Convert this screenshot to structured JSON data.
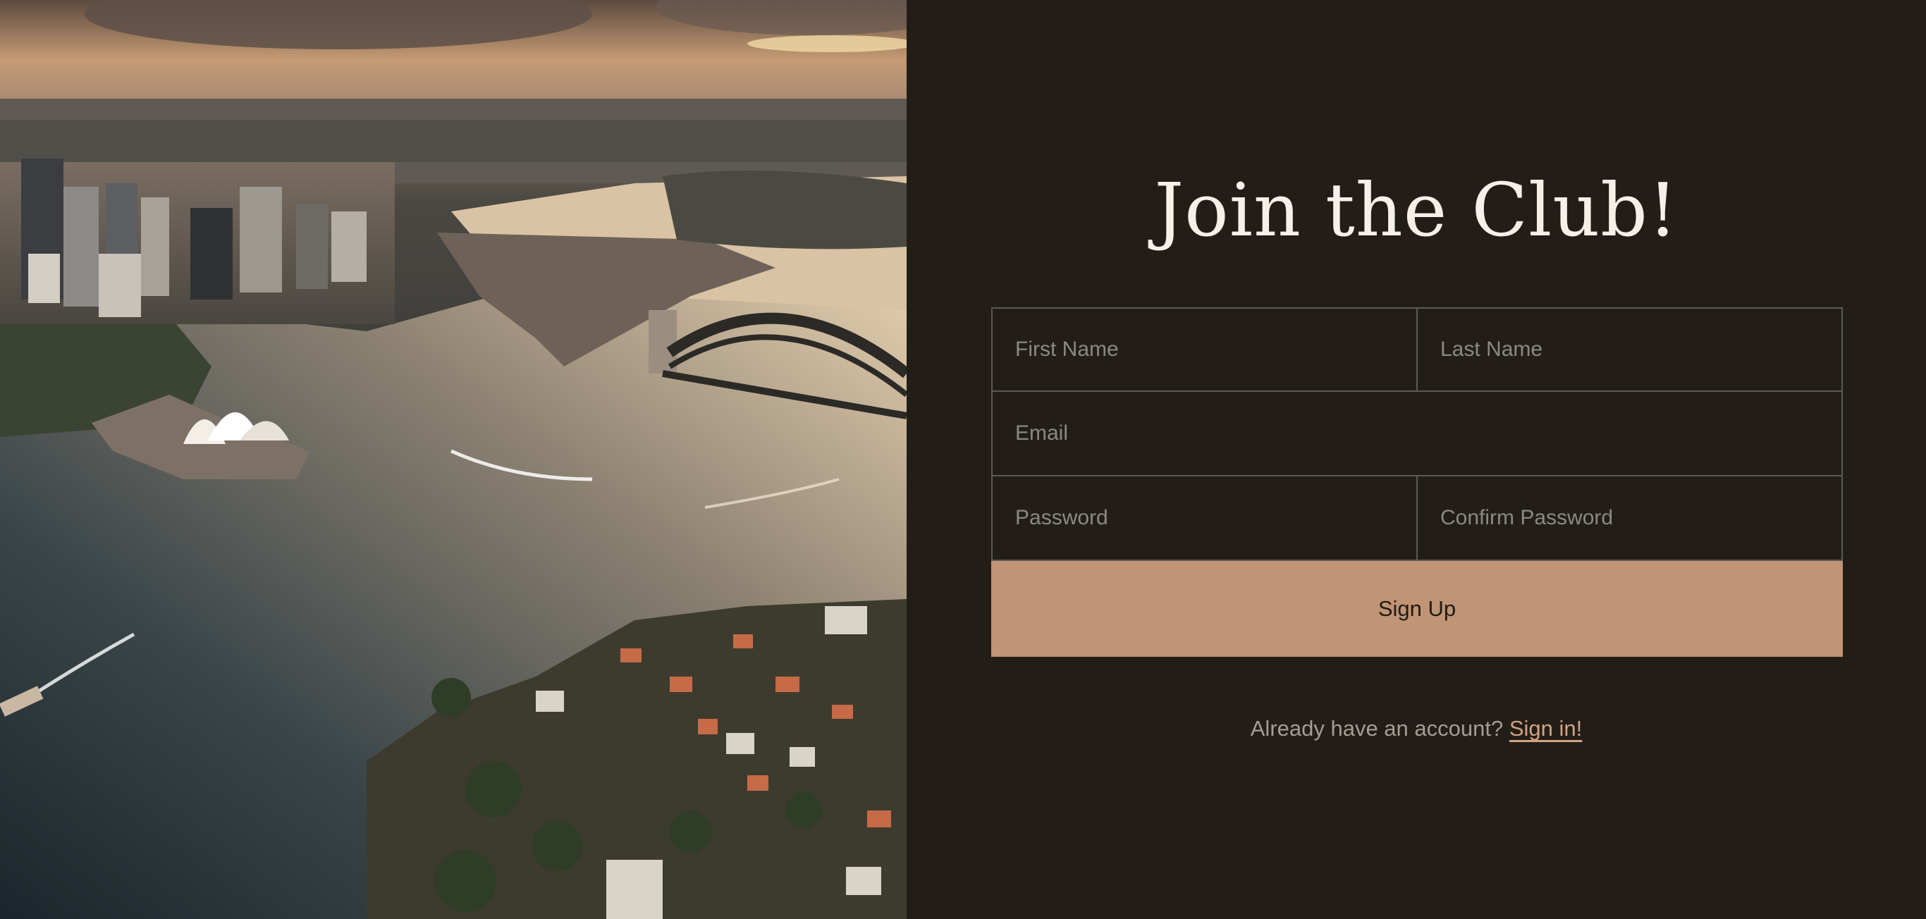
{
  "hero": {
    "description_icon": "city-harbour-photo"
  },
  "form": {
    "title": "Join the Club!",
    "first_name_placeholder": "First Name",
    "last_name_placeholder": "Last Name",
    "email_placeholder": "Email",
    "password_placeholder": "Password",
    "confirm_password_placeholder": "Confirm Password",
    "submit_label": "Sign Up",
    "signin_prompt": "Already have an account?",
    "signin_link": "Sign in!"
  },
  "colors": {
    "background": "#221e17",
    "accent": "#c09475",
    "link": "#d3a283",
    "border": "#5d5a54",
    "title": "#f5f1e9"
  }
}
